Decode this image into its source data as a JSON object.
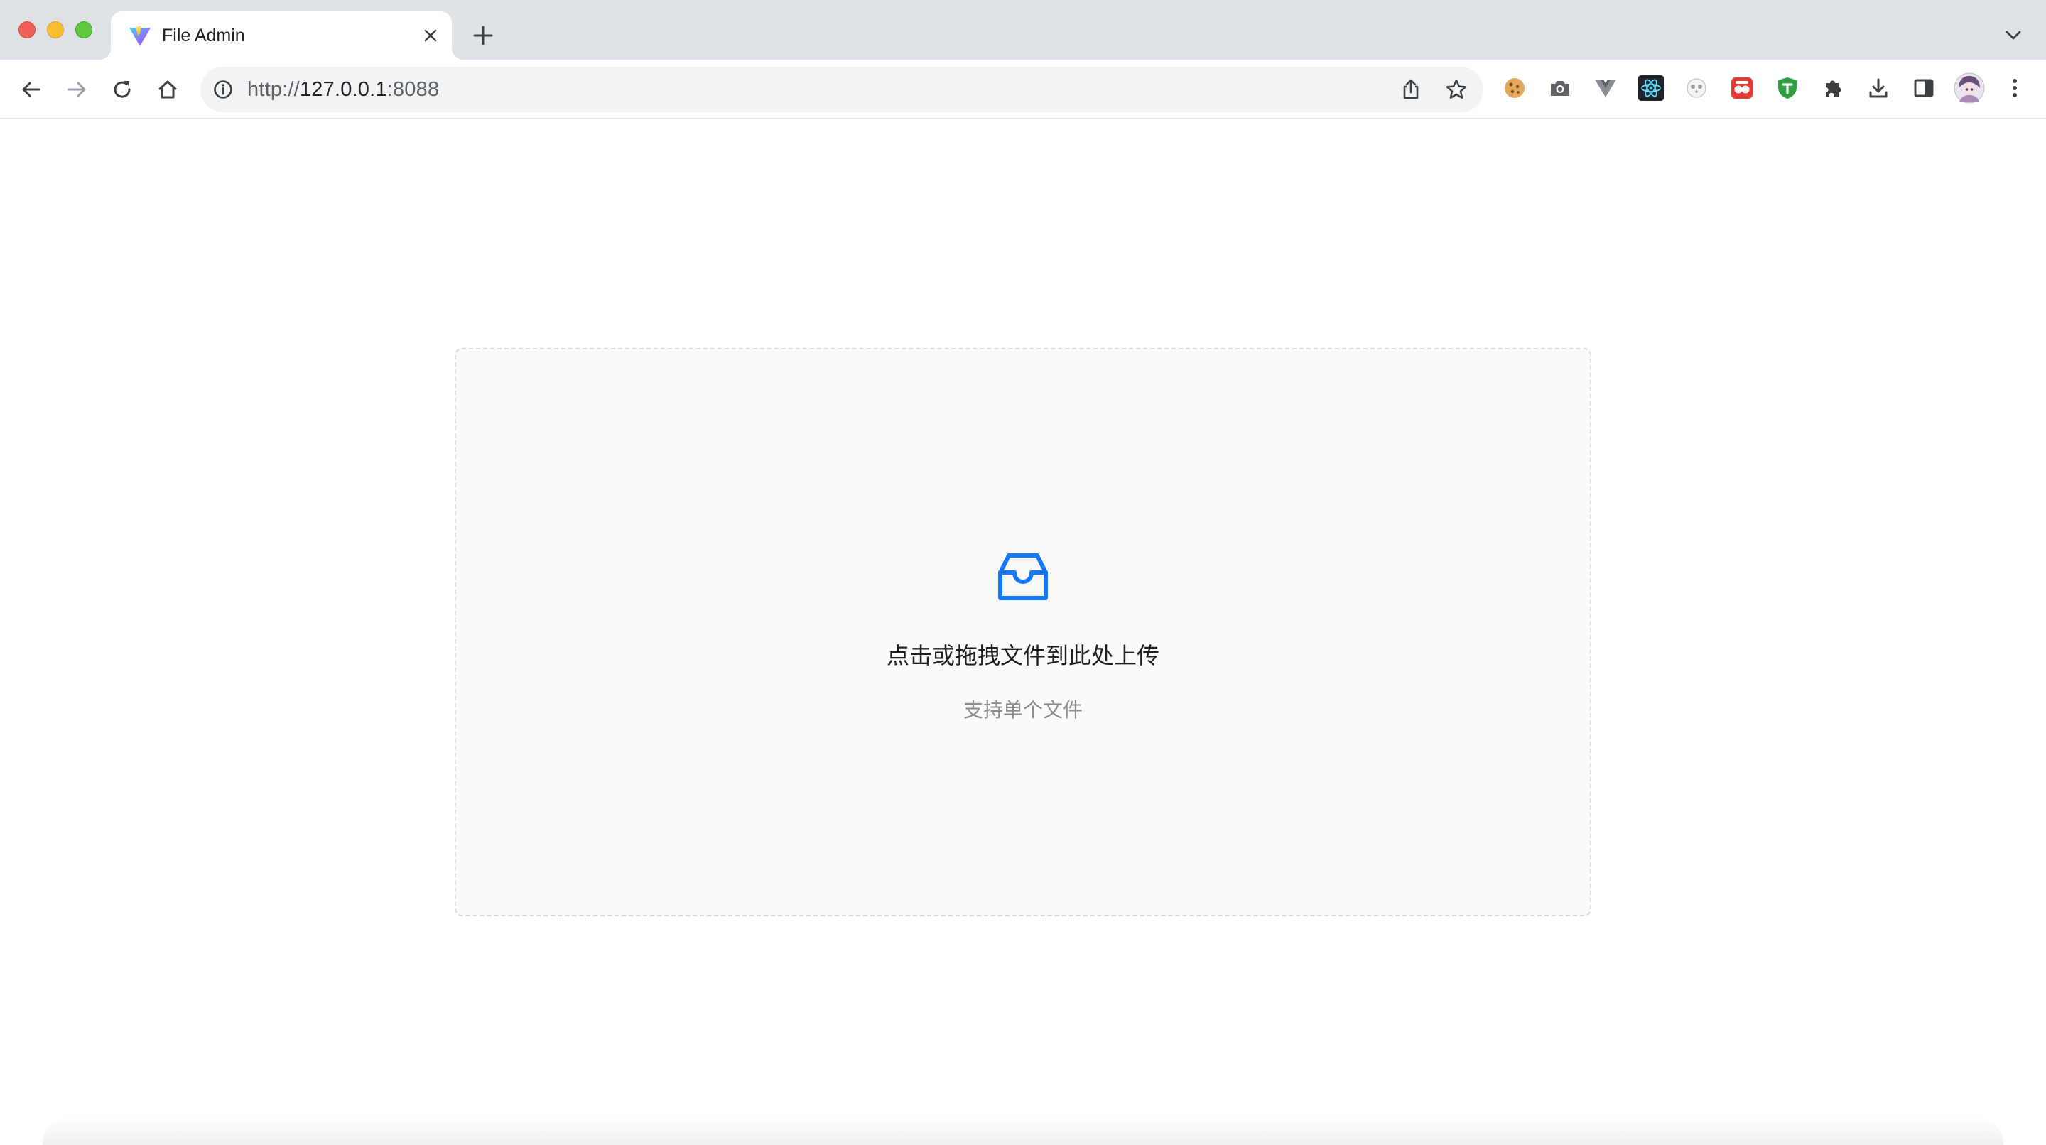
{
  "browser": {
    "tab": {
      "title": "File Admin",
      "favicon": "vite-logo-icon"
    },
    "address": {
      "scheme": "http://",
      "host": "127.0.0.1",
      "port": ":8088"
    },
    "toolbar_icons": [
      "back-icon",
      "forward-icon",
      "reload-icon",
      "home-icon",
      "info-icon",
      "share-icon",
      "star-icon"
    ],
    "extensions": [
      "cookie-icon",
      "camera-icon",
      "vue-devtools-icon",
      "react-devtools-icon",
      "panda-icon",
      "dual-icon",
      "shield-icon",
      "puzzle-icon",
      "download-icon",
      "sidepanel-icon",
      "avatar",
      "more-icon"
    ]
  },
  "upload": {
    "icon": "inbox-icon",
    "text": "点击或拖拽文件到此处上传",
    "hint": "支持单个文件",
    "accent": "#1677ff"
  }
}
